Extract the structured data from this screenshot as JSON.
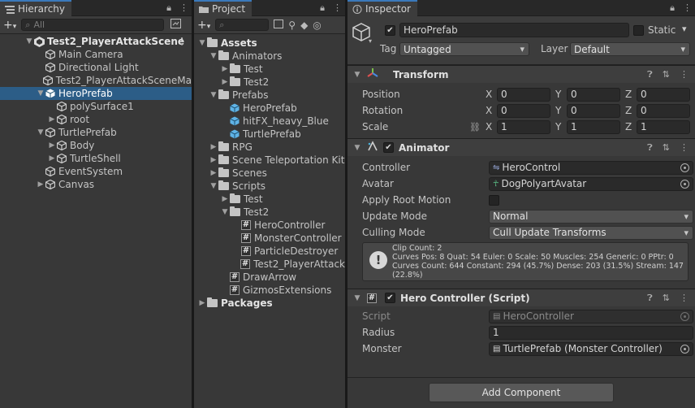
{
  "hierarchy": {
    "tab": "Hierarchy",
    "search_placeholder": "All",
    "scene": "Test2_PlayerAttackScene",
    "items": [
      {
        "label": "Main Camera",
        "depth": 1,
        "arrow": "",
        "icon": "gameobject"
      },
      {
        "label": "Directional Light",
        "depth": 1,
        "arrow": "",
        "icon": "gameobject"
      },
      {
        "label": "Test2_PlayerAttackSceneMa",
        "depth": 1,
        "arrow": "",
        "icon": "gameobject"
      },
      {
        "label": "HeroPrefab",
        "depth": 1,
        "arrow": "▼",
        "icon": "prefab",
        "selected": true
      },
      {
        "label": "polySurface1",
        "depth": 2,
        "arrow": "",
        "icon": "gameobject"
      },
      {
        "label": "root",
        "depth": 2,
        "arrow": "▶",
        "icon": "gameobject"
      },
      {
        "label": "TurtlePrefab",
        "depth": 1,
        "arrow": "▼",
        "icon": "gameobject"
      },
      {
        "label": "Body",
        "depth": 2,
        "arrow": "▶",
        "icon": "gameobject"
      },
      {
        "label": "TurtleShell",
        "depth": 2,
        "arrow": "▶",
        "icon": "gameobject"
      },
      {
        "label": "EventSystem",
        "depth": 1,
        "arrow": "",
        "icon": "gameobject"
      },
      {
        "label": "Canvas",
        "depth": 1,
        "arrow": "▶",
        "icon": "gameobject"
      }
    ]
  },
  "project": {
    "tab": "Project",
    "items": [
      {
        "label": "Assets",
        "depth": 0,
        "arrow": "▼",
        "icon": "folder",
        "bold": true
      },
      {
        "label": "Animators",
        "depth": 1,
        "arrow": "▼",
        "icon": "folder"
      },
      {
        "label": "Test",
        "depth": 2,
        "arrow": "▶",
        "icon": "folder"
      },
      {
        "label": "Test2",
        "depth": 2,
        "arrow": "▶",
        "icon": "folder"
      },
      {
        "label": "Prefabs",
        "depth": 1,
        "arrow": "▼",
        "icon": "folder"
      },
      {
        "label": "HeroPrefab",
        "depth": 2,
        "arrow": "",
        "icon": "prefab"
      },
      {
        "label": "hitFX_heavy_Blue",
        "depth": 2,
        "arrow": "",
        "icon": "prefab"
      },
      {
        "label": "TurtlePrefab",
        "depth": 2,
        "arrow": "",
        "icon": "prefab"
      },
      {
        "label": "RPG",
        "depth": 1,
        "arrow": "▶",
        "icon": "folder"
      },
      {
        "label": "Scene Teleportation Kit",
        "depth": 1,
        "arrow": "▶",
        "icon": "folder"
      },
      {
        "label": "Scenes",
        "depth": 1,
        "arrow": "▶",
        "icon": "folder"
      },
      {
        "label": "Scripts",
        "depth": 1,
        "arrow": "▼",
        "icon": "folder"
      },
      {
        "label": "Test",
        "depth": 2,
        "arrow": "▶",
        "icon": "folder"
      },
      {
        "label": "Test2",
        "depth": 2,
        "arrow": "▼",
        "icon": "folder"
      },
      {
        "label": "HeroController",
        "depth": 3,
        "arrow": "",
        "icon": "script"
      },
      {
        "label": "MonsterController",
        "depth": 3,
        "arrow": "",
        "icon": "script"
      },
      {
        "label": "ParticleDestroyer",
        "depth": 3,
        "arrow": "",
        "icon": "script"
      },
      {
        "label": "Test2_PlayerAttack",
        "depth": 3,
        "arrow": "",
        "icon": "script"
      },
      {
        "label": "DrawArrow",
        "depth": 2,
        "arrow": "",
        "icon": "script"
      },
      {
        "label": "GizmosExtensions",
        "depth": 2,
        "arrow": "",
        "icon": "script"
      },
      {
        "label": "Packages",
        "depth": 0,
        "arrow": "▶",
        "icon": "folder",
        "bold": true
      }
    ]
  },
  "inspector": {
    "tab": "Inspector",
    "object_name": "HeroPrefab",
    "static_label": "Static",
    "tag_label": "Tag",
    "tag_value": "Untagged",
    "layer_label": "Layer",
    "layer_value": "Default",
    "transform": {
      "title": "Transform",
      "rows": [
        {
          "label": "Position",
          "x": "0",
          "y": "0",
          "z": "0"
        },
        {
          "label": "Rotation",
          "x": "0",
          "y": "0",
          "z": "0"
        },
        {
          "label": "Scale",
          "x": "1",
          "y": "1",
          "z": "1"
        }
      ]
    },
    "animator": {
      "title": "Animator",
      "controller_label": "Controller",
      "controller_value": "HeroControl",
      "avatar_label": "Avatar",
      "avatar_value": "DogPolyartAvatar",
      "root_motion_label": "Apply Root Motion",
      "update_mode_label": "Update Mode",
      "update_mode_value": "Normal",
      "culling_mode_label": "Culling Mode",
      "culling_mode_value": "Cull Update Transforms",
      "info_lines": [
        "Clip Count: 2",
        "Curves Pos: 8 Quat: 54 Euler: 0 Scale: 50 Muscles: 254 Generic: 0 PPtr: 0",
        "Curves Count: 644 Constant: 294 (45.7%) Dense: 203 (31.5%) Stream: 147",
        "(22.8%)"
      ]
    },
    "hero_controller": {
      "title": "Hero Controller (Script)",
      "script_label": "Script",
      "script_value": "HeroController",
      "radius_label": "Radius",
      "radius_value": "1",
      "monster_label": "Monster",
      "monster_value": "TurtlePrefab (Monster Controller)"
    },
    "add_component": "Add Component"
  },
  "colors": {
    "selection": "#2c5d87",
    "accent": "#3a79bb",
    "prefab_blue": "#5fb3e6"
  }
}
